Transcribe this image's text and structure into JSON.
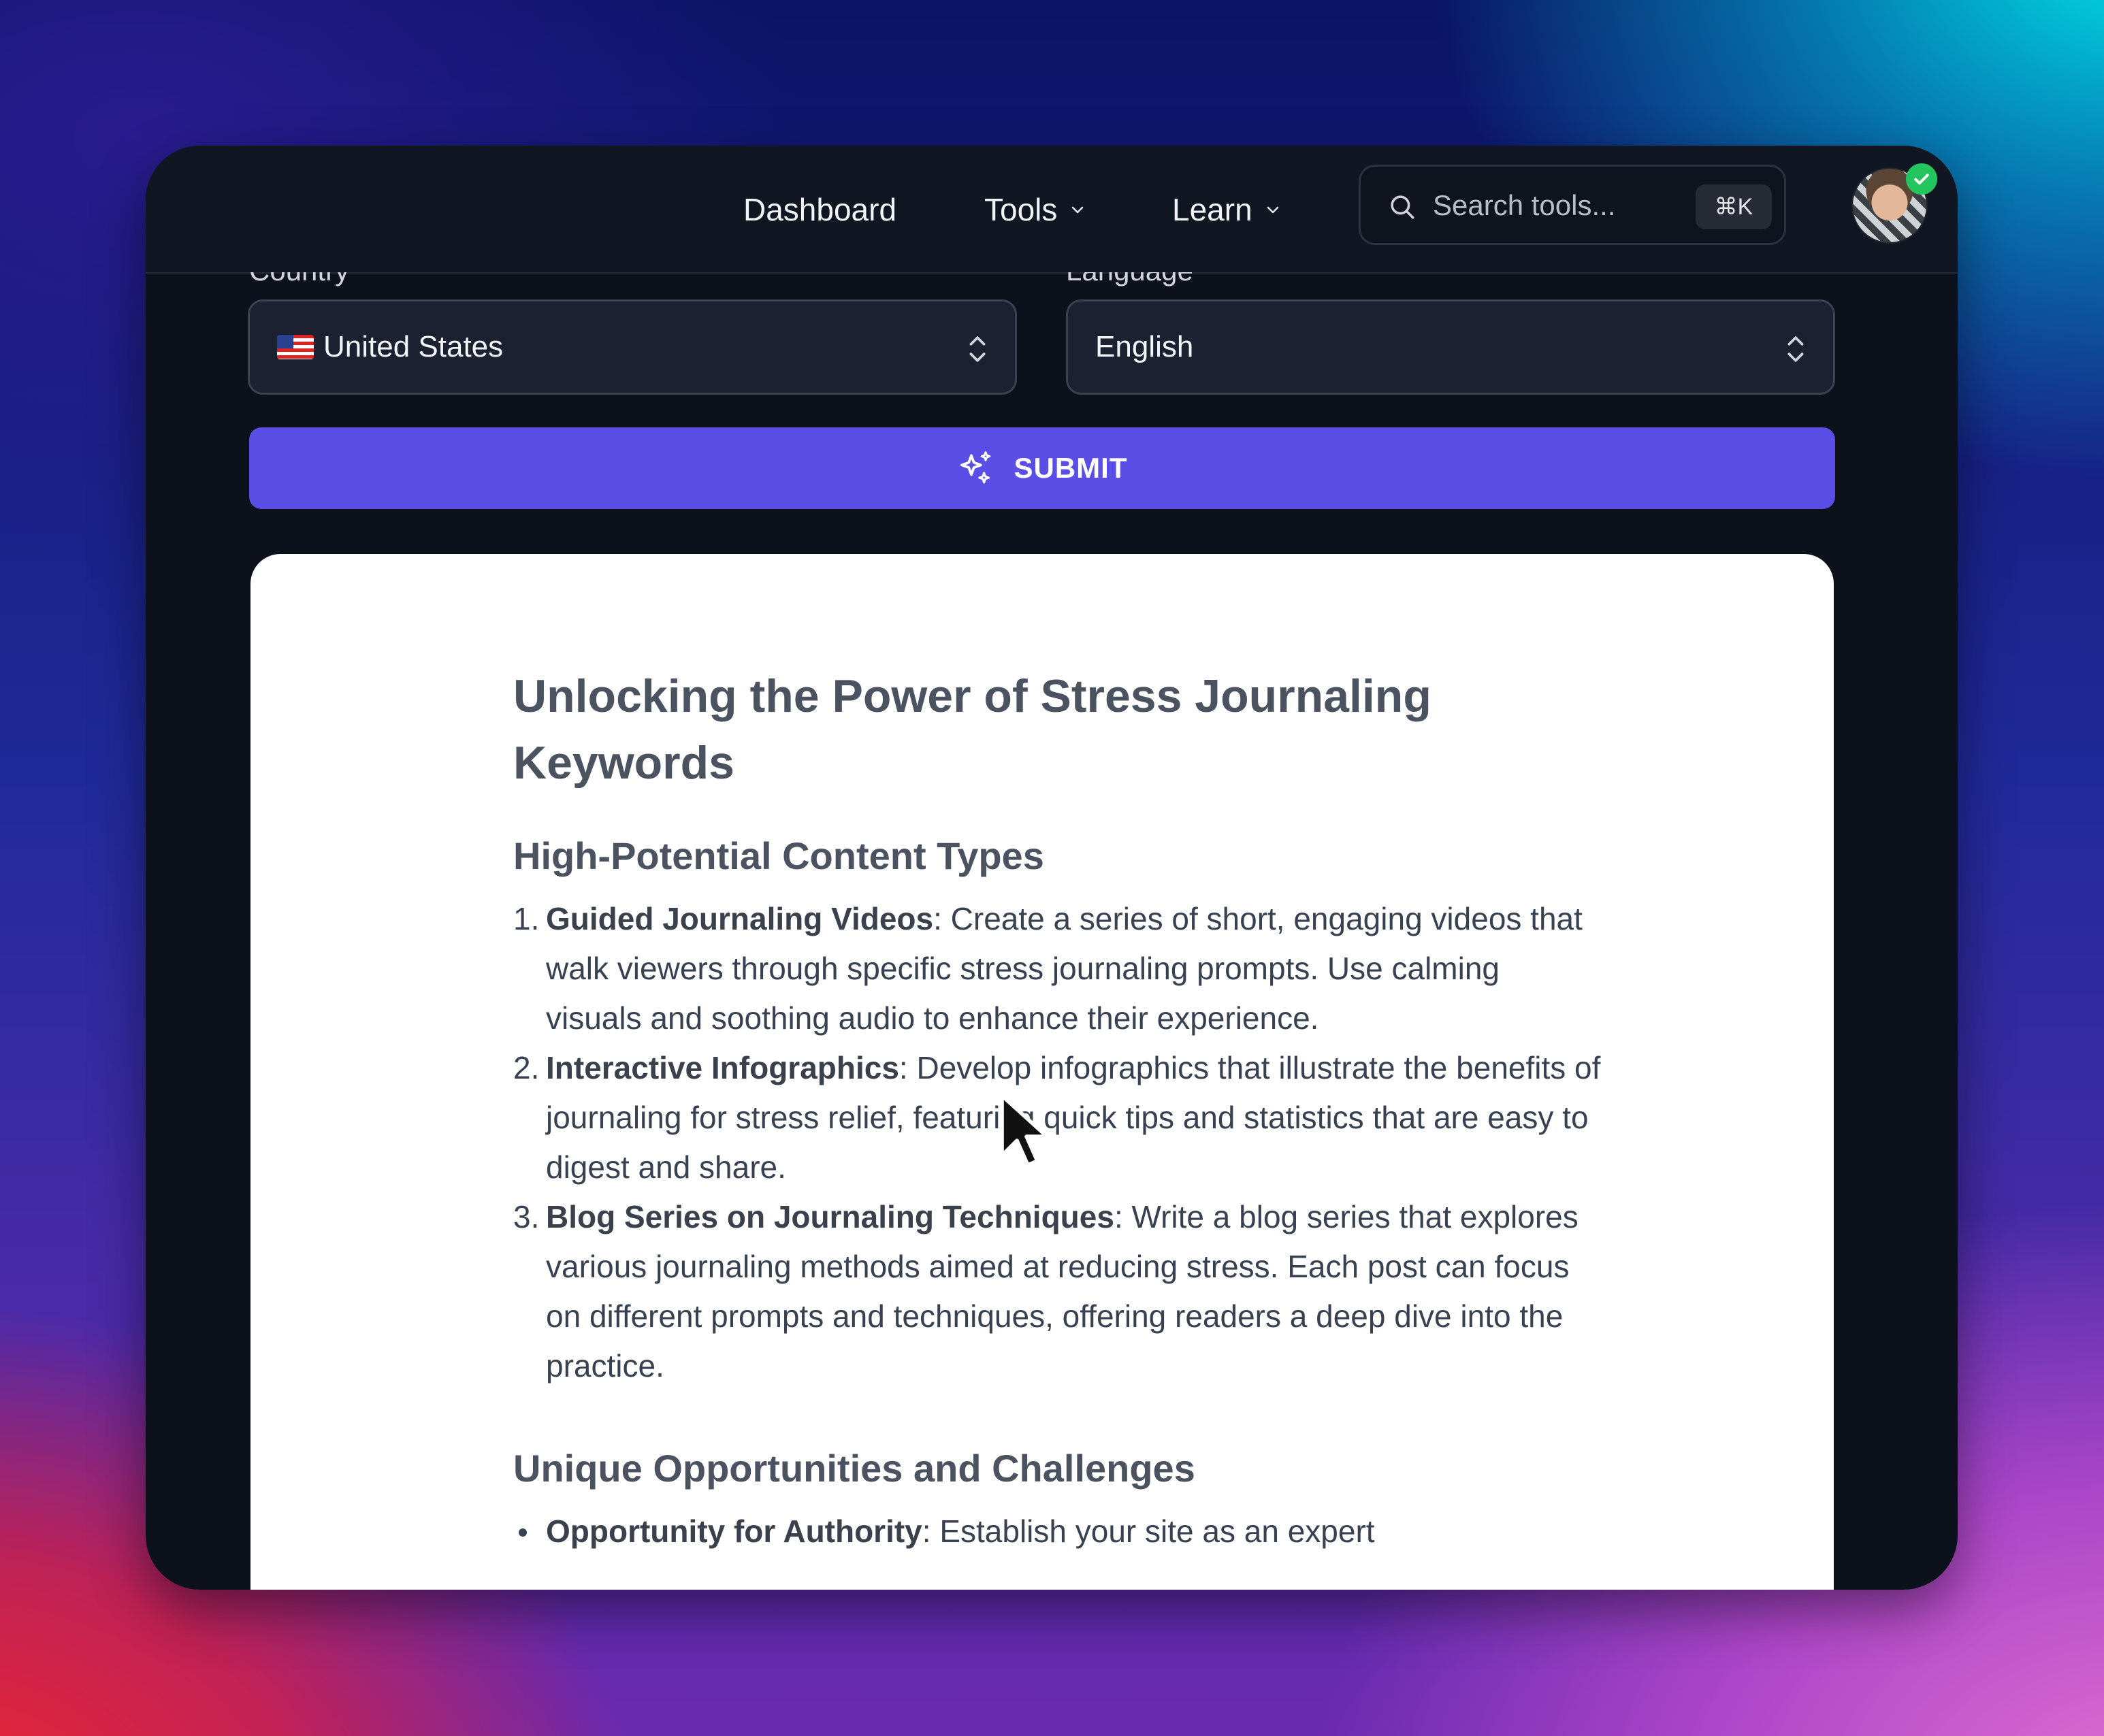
{
  "nav": {
    "items": [
      {
        "label": "Dashboard",
        "has_dropdown": false
      },
      {
        "label": "Tools",
        "has_dropdown": true
      },
      {
        "label": "Learn",
        "has_dropdown": true
      }
    ],
    "search": {
      "placeholder": "Search tools...",
      "value": "",
      "shortcut": "⌘K"
    },
    "avatar": {
      "verified": true
    }
  },
  "form": {
    "country": {
      "label": "Country",
      "value": "United States"
    },
    "language": {
      "label": "Language",
      "value": "English"
    },
    "submit_label": "SUBMIT"
  },
  "article": {
    "title": "Unlocking the Power of Stress Journaling Keywords",
    "section1": {
      "heading": "High-Potential Content Types",
      "items": [
        {
          "num": "1.",
          "bold": "Guided Journaling Videos",
          "text": ": Create a series of short, engaging videos that walk viewers through specific stress journaling prompts. Use calming visuals and soothing audio to enhance their experience."
        },
        {
          "num": "2.",
          "bold": "Interactive Infographics",
          "text": ": Develop infographics that illustrate the benefits of journaling for stress relief, featuring quick tips and statistics that are easy to digest and share."
        },
        {
          "num": "3.",
          "bold": "Blog Series on Journaling Techniques",
          "text": ": Write a blog series that explores various journaling methods aimed at reducing stress. Each post can focus on different prompts and techniques, offering readers a deep dive into the practice."
        }
      ]
    },
    "section2": {
      "heading": "Unique Opportunities and Challenges",
      "items": [
        {
          "bold": "Opportunity for Authority",
          "text": ": Establish your site as an expert"
        }
      ]
    }
  },
  "colors": {
    "accent": "#5a4ee6",
    "window_bg": "#0d111c",
    "verified": "#22c55e"
  }
}
